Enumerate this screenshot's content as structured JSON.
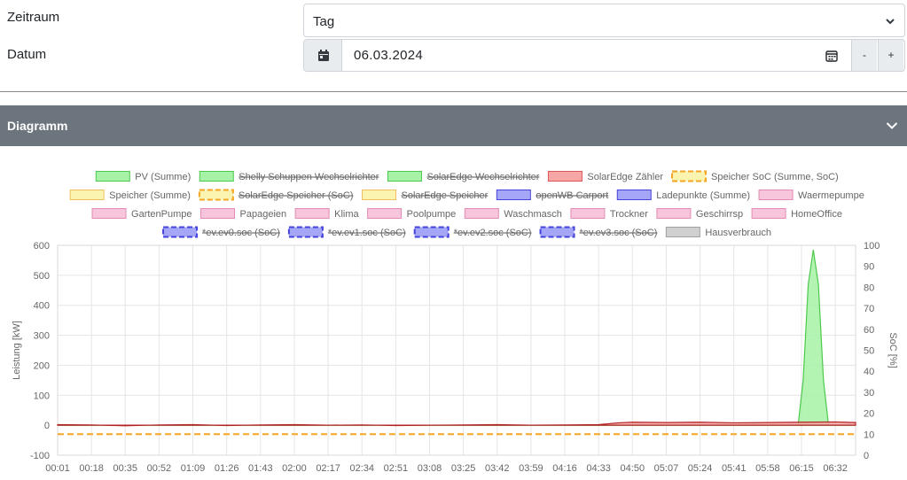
{
  "form": {
    "period_label": "Zeitraum",
    "period_value": "Tag",
    "date_label": "Datum",
    "date_value": "06.03.2024",
    "minus_label": "-",
    "plus_label": "+"
  },
  "panel": {
    "title": "Diagramm"
  },
  "chart_data": {
    "type": "area",
    "ylabel_left": "Leistung [kW]",
    "ylabel_right": "SoC [%]",
    "ylim_left": [
      -100,
      600
    ],
    "ylim_right": [
      0,
      100
    ],
    "yticks_left": [
      -100,
      0,
      100,
      200,
      300,
      400,
      500,
      600
    ],
    "yticks_right": [
      0,
      10,
      20,
      30,
      40,
      50,
      60,
      70,
      80,
      90,
      100
    ],
    "x_ticks": [
      "00:01",
      "00:18",
      "00:35",
      "00:52",
      "01:09",
      "01:26",
      "01:43",
      "02:00",
      "02:17",
      "02:34",
      "02:51",
      "03:08",
      "03:25",
      "03:42",
      "03:59",
      "04:16",
      "04:33",
      "04:50",
      "05:07",
      "05:24",
      "05:41",
      "05:58",
      "06:15",
      "06:32"
    ],
    "grid": true,
    "legend_position": "top",
    "legend": [
      {
        "name": "PV (Summe)",
        "fill": "#a6f2a6",
        "stroke": "#4cc94c",
        "dashed": false,
        "hidden": false
      },
      {
        "name": "Shelly Schuppen Wechselrichter",
        "fill": "#a6f2a6",
        "stroke": "#4cc94c",
        "dashed": false,
        "hidden": true
      },
      {
        "name": "SolarEdge Wechselrichter",
        "fill": "#a6f2a6",
        "stroke": "#4cc94c",
        "dashed": false,
        "hidden": true
      },
      {
        "name": "SolarEdge Zähler",
        "fill": "#f7a6a6",
        "stroke": "#e05555",
        "dashed": false,
        "hidden": false
      },
      {
        "name": "Speicher SoC (Summe, SoC)",
        "fill": "#fbf3b0",
        "stroke": "#f5a623",
        "dashed": true,
        "hidden": false
      },
      {
        "name": "Speicher (Summe)",
        "fill": "#fbf3b0",
        "stroke": "#f0c060",
        "dashed": false,
        "hidden": false
      },
      {
        "name": "SolarEdge Speicher (SoC)",
        "fill": "#fbf3b0",
        "stroke": "#f5a623",
        "dashed": true,
        "hidden": true
      },
      {
        "name": "SolarEdge Speicher",
        "fill": "#fbf3b0",
        "stroke": "#f0c060",
        "dashed": false,
        "hidden": true
      },
      {
        "name": "openWB Carport",
        "fill": "#a6a6f7",
        "stroke": "#4444dd",
        "dashed": false,
        "hidden": true
      },
      {
        "name": "Ladepunkte (Summe)",
        "fill": "#a6a6f7",
        "stroke": "#4444dd",
        "dashed": false,
        "hidden": false
      },
      {
        "name": "Waermepumpe",
        "fill": "#f8c6dc",
        "stroke": "#e38bb5",
        "dashed": false,
        "hidden": false
      },
      {
        "name": "GartenPumpe",
        "fill": "#f8c6dc",
        "stroke": "#e38bb5",
        "dashed": false,
        "hidden": false
      },
      {
        "name": "Papageien",
        "fill": "#f8c6dc",
        "stroke": "#e38bb5",
        "dashed": false,
        "hidden": false
      },
      {
        "name": "Klima",
        "fill": "#f8c6dc",
        "stroke": "#e38bb5",
        "dashed": false,
        "hidden": false
      },
      {
        "name": "Poolpumpe",
        "fill": "#f8c6dc",
        "stroke": "#e38bb5",
        "dashed": false,
        "hidden": false
      },
      {
        "name": "Waschmasch",
        "fill": "#f8c6dc",
        "stroke": "#e38bb5",
        "dashed": false,
        "hidden": false
      },
      {
        "name": "Trockner",
        "fill": "#f8c6dc",
        "stroke": "#e38bb5",
        "dashed": false,
        "hidden": false
      },
      {
        "name": "Geschirrsp",
        "fill": "#f8c6dc",
        "stroke": "#e38bb5",
        "dashed": false,
        "hidden": false
      },
      {
        "name": "HomeOffice",
        "fill": "#f8c6dc",
        "stroke": "#e38bb5",
        "dashed": false,
        "hidden": false
      },
      {
        "name": "*ev.ev0.soc (SoC)",
        "fill": "#a6a6f7",
        "stroke": "#4444dd",
        "dashed": true,
        "hidden": true
      },
      {
        "name": "*ev.ev1.soc (SoC)",
        "fill": "#a6a6f7",
        "stroke": "#4444dd",
        "dashed": true,
        "hidden": true
      },
      {
        "name": "*ev.ev2.soc (SoC)",
        "fill": "#a6a6f7",
        "stroke": "#4444dd",
        "dashed": true,
        "hidden": true
      },
      {
        "name": "*ev.ev3.soc (SoC)",
        "fill": "#a6a6f7",
        "stroke": "#4444dd",
        "dashed": true,
        "hidden": true
      },
      {
        "name": "Hausverbrauch",
        "fill": "#d0d0d0",
        "stroke": "#a0a0a0",
        "dashed": false,
        "hidden": false
      }
    ],
    "series": [
      {
        "name": "PV (Summe)",
        "fill": "#a6f2a6",
        "stroke": "#4cc94c",
        "x": [
          0.0,
          21.9,
          22.05,
          22.2,
          22.35,
          22.5,
          22.65,
          22.8,
          23.6
        ],
        "y": [
          0,
          0,
          150,
          470,
          585,
          470,
          150,
          0,
          0
        ]
      },
      {
        "name": "SolarEdge Zähler",
        "fill": "#f7a6a6",
        "stroke": "#b22222",
        "x": [
          0,
          1,
          2,
          3,
          4,
          5,
          6,
          7,
          8,
          9,
          10,
          11,
          12,
          13,
          14,
          15,
          16,
          16.6,
          17,
          18,
          19,
          20,
          21,
          22,
          23,
          23.6
        ],
        "y": [
          2,
          1,
          -2,
          1,
          2,
          -1,
          1,
          2,
          0,
          1,
          -1,
          0,
          1,
          2,
          0,
          1,
          2,
          8,
          10,
          9,
          10,
          8,
          9,
          10,
          11,
          9
        ]
      },
      {
        "name": "Speicher SoC (Summe, SoC)",
        "axis": "right",
        "stroke": "#f5a623",
        "dashed": true,
        "x": [
          0,
          23.6
        ],
        "y": [
          10,
          10
        ]
      }
    ]
  }
}
